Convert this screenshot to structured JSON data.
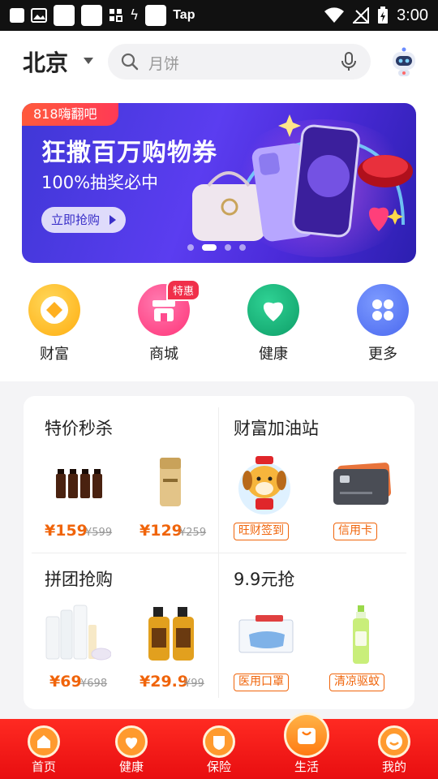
{
  "status_bar": {
    "tap_label": "Tap",
    "time": "3:00"
  },
  "header": {
    "city": "北京",
    "search_placeholder": "月饼"
  },
  "banner": {
    "tag": "818嗨翻吧",
    "title": "狂撒百万购物券",
    "subtitle": "100%抽奖必中",
    "button": "立即抢购",
    "pages": 4,
    "active_page": 2
  },
  "quick_nav": [
    {
      "label": "财富",
      "icon": "wealth-icon",
      "color": "#ffb020"
    },
    {
      "label": "商城",
      "icon": "store-icon",
      "color": "#ff4b8e",
      "badge": "特惠"
    },
    {
      "label": "健康",
      "icon": "heart-icon",
      "color": "#16b27a"
    },
    {
      "label": "更多",
      "icon": "more-icon",
      "color": "#5b7cf5"
    }
  ],
  "deals": {
    "flash_sale": {
      "title": "特价秒杀",
      "items": [
        {
          "price": "¥159",
          "original": "¥599"
        },
        {
          "price": "¥129",
          "original": "¥259"
        }
      ]
    },
    "wealth_station": {
      "title": "财富加油站",
      "tags": [
        "旺财签到",
        "信用卡"
      ]
    },
    "group_buy": {
      "title": "拼团抢购",
      "items": [
        {
          "price": "¥69",
          "original": "¥698"
        },
        {
          "price": "¥29.9",
          "original": "¥99"
        }
      ]
    },
    "nine_nine": {
      "title": "9.9元抢",
      "tags": [
        "医用口罩",
        "清凉驱蚊"
      ]
    }
  },
  "tab_bar": [
    {
      "label": "首页",
      "icon": "home-icon"
    },
    {
      "label": "健康",
      "icon": "heart-icon"
    },
    {
      "label": "保险",
      "icon": "shield-icon"
    },
    {
      "label": "生活",
      "icon": "bag-icon",
      "active": true
    },
    {
      "label": "我的",
      "icon": "smile-icon"
    }
  ],
  "colors": {
    "accent": "#f0640a",
    "tabbar": "#ff2a22",
    "banner": "#4a2ad8"
  }
}
